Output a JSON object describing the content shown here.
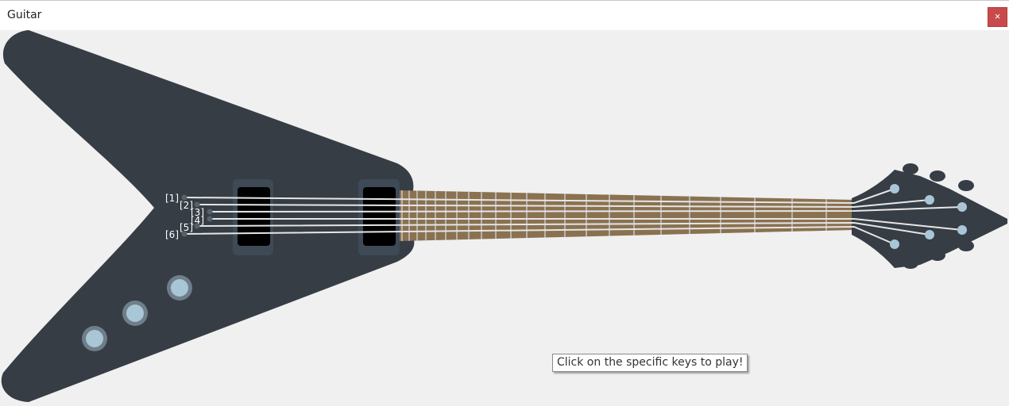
{
  "window": {
    "title": "Guitar",
    "close_label": "×"
  },
  "guitar": {
    "string_labels": [
      "[1]",
      "[2]",
      "[3]",
      "[4]",
      "[5]",
      "[6]"
    ],
    "colors": {
      "body": "#363d45",
      "pickup_ring": "#3e4a56",
      "pickup": "#000000",
      "fretboard": "#8a7150",
      "fret": "#c9c9c9",
      "string": "#e6e6e6",
      "knob": "#a9c6d6",
      "knob_ring": "#6e7f8a",
      "string_pin": "#55626b"
    }
  },
  "hint": {
    "text": "Click on the specific keys to play!"
  }
}
